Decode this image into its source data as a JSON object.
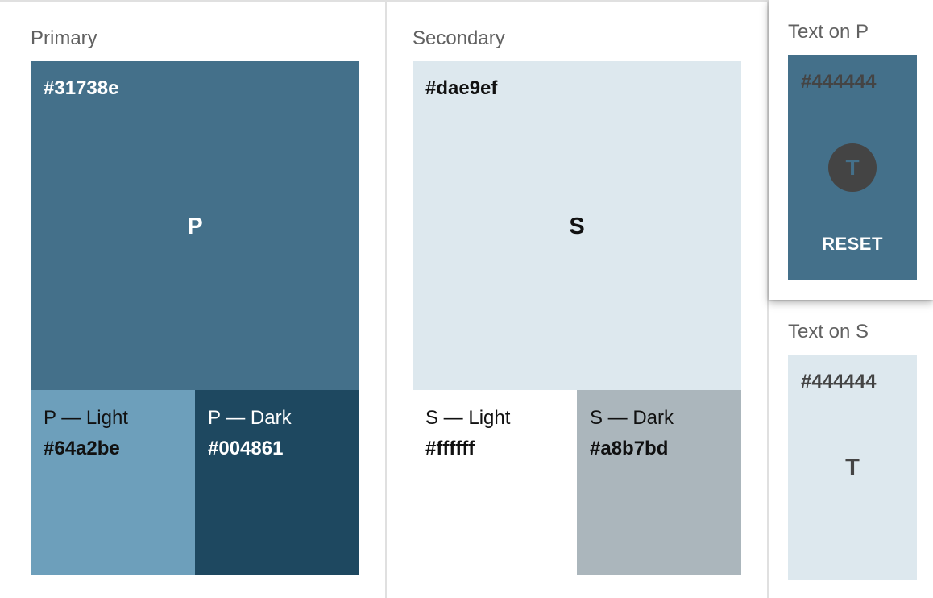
{
  "primary": {
    "label": "Primary",
    "main": {
      "hex": "#31738e",
      "letter": "P",
      "bg": "#44708a",
      "text": "#ffffff"
    },
    "light": {
      "name": "P — Light",
      "hex": "#64a2be",
      "bg": "#6d9fbb",
      "text": "#111111"
    },
    "dark": {
      "name": "P — Dark",
      "hex": "#004861",
      "bg": "#1e4860",
      "text": "#ffffff"
    }
  },
  "secondary": {
    "label": "Secondary",
    "main": {
      "hex": "#dae9ef",
      "letter": "S",
      "bg": "#dde8ee",
      "text": "#111111"
    },
    "light": {
      "name": "S — Light",
      "hex": "#ffffff",
      "bg": "#ffffff",
      "text": "#111111"
    },
    "dark": {
      "name": "S — Dark",
      "hex": "#a8b7bd",
      "bg": "#abb6bc",
      "text": "#111111"
    }
  },
  "text_on_p": {
    "label": "Text on P",
    "hex": "#444444",
    "avatar_letter": "T",
    "reset_label": "RESET",
    "bg": "#44708a",
    "text_color": "#444444",
    "reset_color": "#ffffff"
  },
  "text_on_s": {
    "label": "Text on S",
    "hex": "#444444",
    "letter": "T",
    "bg": "#dde8ee",
    "text_color": "#444444"
  }
}
